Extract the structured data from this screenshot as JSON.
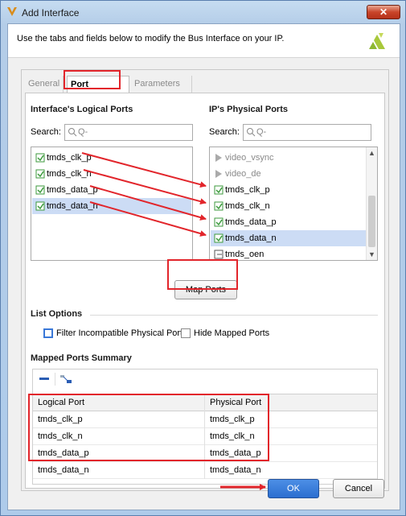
{
  "window": {
    "title": "Add Interface",
    "close_label": "✕"
  },
  "header": {
    "description": "Use the tabs and fields below to modify the Bus Interface on your IP."
  },
  "tabs": [
    {
      "label": "General",
      "active": false
    },
    {
      "label": "Port Mapping",
      "active": true
    },
    {
      "label": "Parameters",
      "active": false
    }
  ],
  "logical_ports": {
    "title": "Interface's Logical Ports",
    "search_label": "Search:",
    "search_placeholder": "Q-",
    "items": [
      {
        "label": "tmds_clk_p",
        "selected": false
      },
      {
        "label": "tmds_clk_n",
        "selected": false
      },
      {
        "label": "tmds_data_p",
        "selected": false
      },
      {
        "label": "tmds_data_n",
        "selected": true
      }
    ]
  },
  "physical_ports": {
    "title": "IP's Physical Ports",
    "search_label": "Search:",
    "search_placeholder": "Q-",
    "items": [
      {
        "label": "video_vsync",
        "dim": true,
        "selected": false
      },
      {
        "label": "video_de",
        "dim": true,
        "selected": false
      },
      {
        "label": "tmds_clk_p",
        "dim": false,
        "selected": false
      },
      {
        "label": "tmds_clk_n",
        "dim": false,
        "selected": false
      },
      {
        "label": "tmds_data_p",
        "dim": false,
        "selected": false
      },
      {
        "label": "tmds_data_n",
        "dim": false,
        "selected": true
      },
      {
        "label": "tmds_oen",
        "dim": false,
        "selected": false
      }
    ]
  },
  "map_ports_button": "Map Ports",
  "list_options": {
    "title": "List Options",
    "filter_label": "Filter Incompatible Physical Ports",
    "hide_label": "Hide Mapped Ports"
  },
  "summary": {
    "title": "Mapped Ports Summary",
    "columns": [
      "Logical Port",
      "Physical Port"
    ],
    "rows": [
      [
        "tmds_clk_p",
        "tmds_clk_p"
      ],
      [
        "tmds_clk_n",
        "tmds_clk_n"
      ],
      [
        "tmds_data_p",
        "tmds_data_p"
      ],
      [
        "tmds_data_n",
        "tmds_data_n"
      ]
    ]
  },
  "footer": {
    "ok_label": "OK",
    "cancel_label": "Cancel"
  },
  "colors": {
    "accent": "#2b6ed0",
    "annotation": "#e2252b",
    "selection": "#ccdcf5",
    "port_icon": "#3c9a3c"
  },
  "icons": {
    "title": "vivado-logo-icon",
    "logo": "xilinx-logo-icon",
    "search": "search-icon",
    "port": "port-icon",
    "remove": "remove-icon",
    "auto": "auto-connect-icon"
  }
}
